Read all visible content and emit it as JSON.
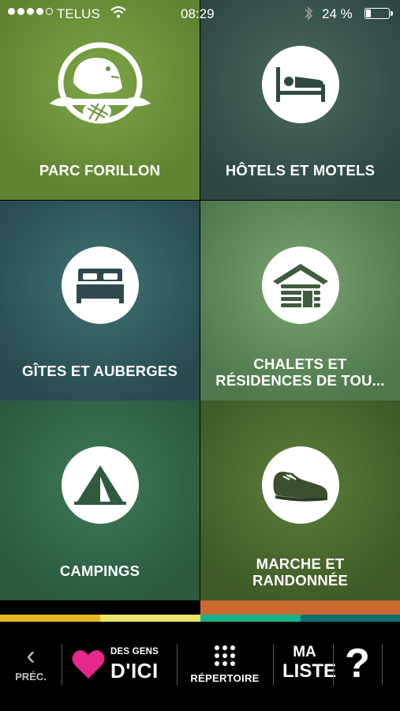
{
  "status_bar": {
    "carrier": "TELUS",
    "time": "08:29",
    "battery_percent": "24 %",
    "battery_level": 0.24,
    "signal_bars_filled": 4,
    "signal_bars_total": 5
  },
  "tiles": [
    {
      "label": "PARC FORILLON",
      "icon": "beaver-logo-icon"
    },
    {
      "label": "HÔTELS ET MOTELS",
      "icon": "bed-sleeping-icon"
    },
    {
      "label": "GÎTES ET AUBERGES",
      "icon": "double-bed-icon"
    },
    {
      "label_line1": "CHALETS ET",
      "label_line2": "RÉSIDENCES DE TOU...",
      "icon": "log-cabin-icon"
    },
    {
      "label": "CAMPINGS",
      "icon": "tent-icon"
    },
    {
      "label_line1": "MARCHE ET",
      "label_line2": "RANDONNÉE",
      "icon": "hiking-shoe-icon"
    }
  ],
  "strips": {
    "colors": [
      "#e8b91e",
      "#ece46a",
      "#16b38a",
      "#0e6f71"
    ]
  },
  "bottom_nav": {
    "prev_label": "PRÉC.",
    "des_gens_label": "DES GENS",
    "dici_label": "D'ICI",
    "repertoire_label": "RÉPERTOIRE",
    "ma_label": "MA",
    "liste_label": "LISTE",
    "help_label": "?"
  },
  "colors": {
    "heart": "#e8278c",
    "icon_dark": "#2f4a40"
  }
}
